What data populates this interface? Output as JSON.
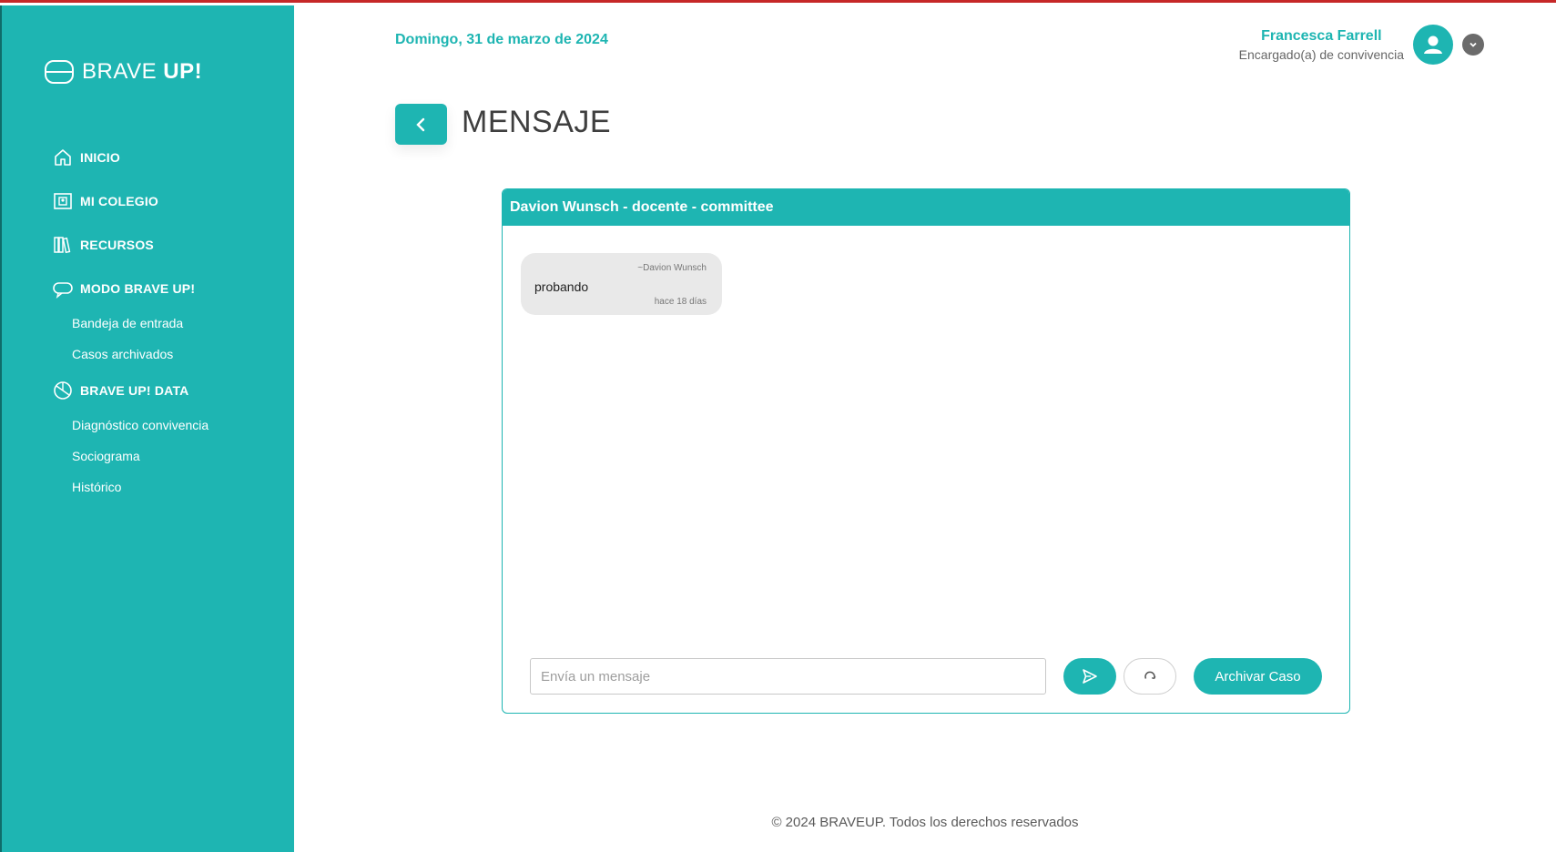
{
  "brand": {
    "logo_light": "BRAVE ",
    "logo_bold": "UP!"
  },
  "sidebar": {
    "items": [
      {
        "label": "INICIO",
        "icon": "home-icon"
      },
      {
        "label": "MI COLEGIO",
        "icon": "school-icon"
      },
      {
        "label": "RECURSOS",
        "icon": "books-icon"
      },
      {
        "label": "MODO BRAVE UP!",
        "icon": "chat-bubble-icon"
      },
      {
        "label": "BRAVE UP! DATA",
        "icon": "pie-chart-icon"
      }
    ],
    "modo_sub": [
      "Bandeja de entrada",
      "Casos archivados"
    ],
    "data_sub": [
      "Diagnóstico convivencia",
      "Sociograma",
      "Histórico"
    ]
  },
  "header": {
    "date": "Domingo, 31 de marzo de 2024",
    "user_name": "Francesca Farrell",
    "user_role": "Encargado(a) de convivencia"
  },
  "page": {
    "title": "MENSAJE"
  },
  "conversation": {
    "header": "Davion Wunsch - docente - committee",
    "messages": [
      {
        "author": "~Davion Wunsch",
        "text": "probando",
        "time": "hace 18 días"
      }
    ],
    "input_placeholder": "Envía un mensaje",
    "archive_label": "Archivar Caso"
  },
  "footer": {
    "text": "© 2024 BRAVEUP. Todos los derechos reservados"
  },
  "colors": {
    "accent": "#1eb5b2",
    "bubble": "#e9e9e9"
  }
}
